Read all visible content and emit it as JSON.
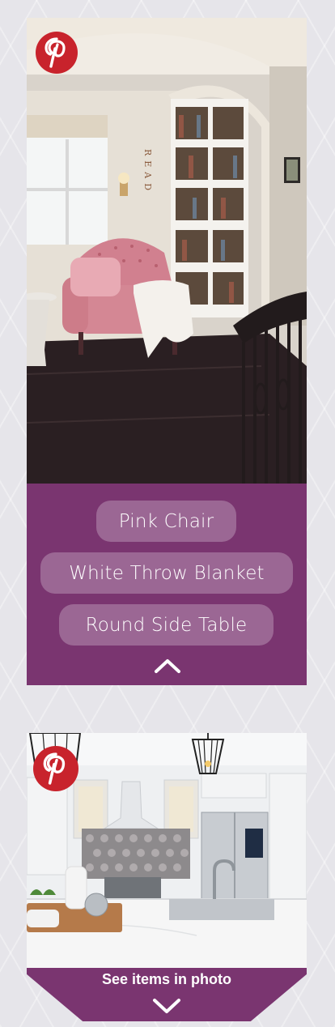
{
  "brand": {
    "logo_icon": "pinterest-logo-icon",
    "color": "#c8232c"
  },
  "accent_color": "#7a3570",
  "card1": {
    "image_alt": "Reading nook with pink tufted chair and built-in bookshelves",
    "sign_text": "READ",
    "tags": [
      "Pink Chair",
      "White Throw Blanket",
      "Round Side Table"
    ],
    "collapse_icon": "chevron-up-icon"
  },
  "card2": {
    "image_alt": "White kitchen with marble island and pendant lights",
    "cta_label": "See items in photo",
    "expand_icon": "chevron-down-icon"
  }
}
